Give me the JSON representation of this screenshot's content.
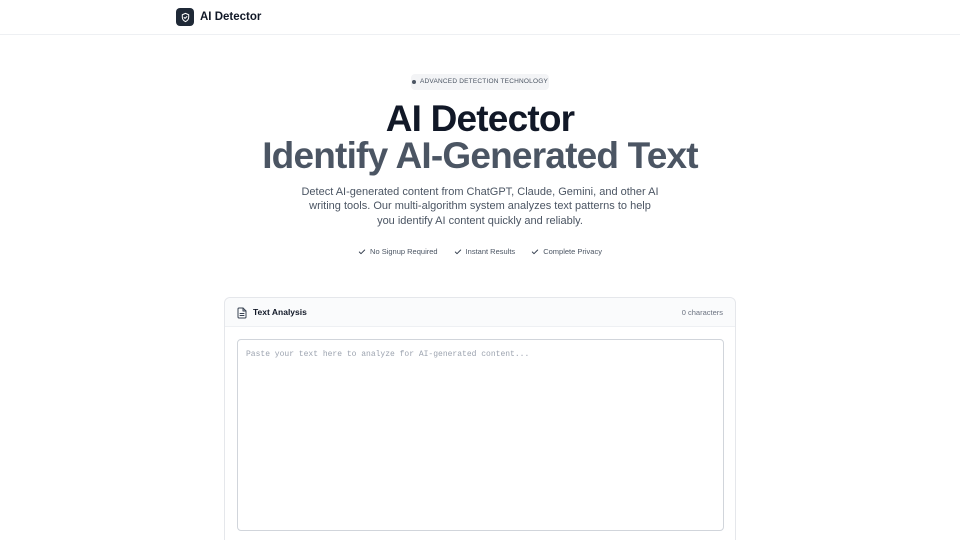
{
  "nav": {
    "brand": "AI Detector",
    "logo_icon": "shield-check-icon"
  },
  "hero": {
    "badge": "ADVANCED DETECTION TECHNOLOGY",
    "title": "AI Detector",
    "subtitle": "Identify AI-Generated Text",
    "description": "Detect AI-generated content from ChatGPT, Claude, Gemini, and other AI writing tools. Our multi-algorithm system analyzes text patterns to help you identify AI content quickly and reliably."
  },
  "features": [
    {
      "label": "No Signup Required",
      "icon": "check-icon"
    },
    {
      "label": "Instant Results",
      "icon": "check-icon"
    },
    {
      "label": "Complete Privacy",
      "icon": "check-icon"
    }
  ],
  "analysis": {
    "title": "Text Analysis",
    "title_icon": "document-icon",
    "char_count": "0 characters",
    "placeholder": "Paste your text here to analyze for AI-generated content...",
    "value": ""
  },
  "colors": {
    "primary": "#1f2937",
    "heading": "#111827",
    "muted": "#4b5563"
  }
}
